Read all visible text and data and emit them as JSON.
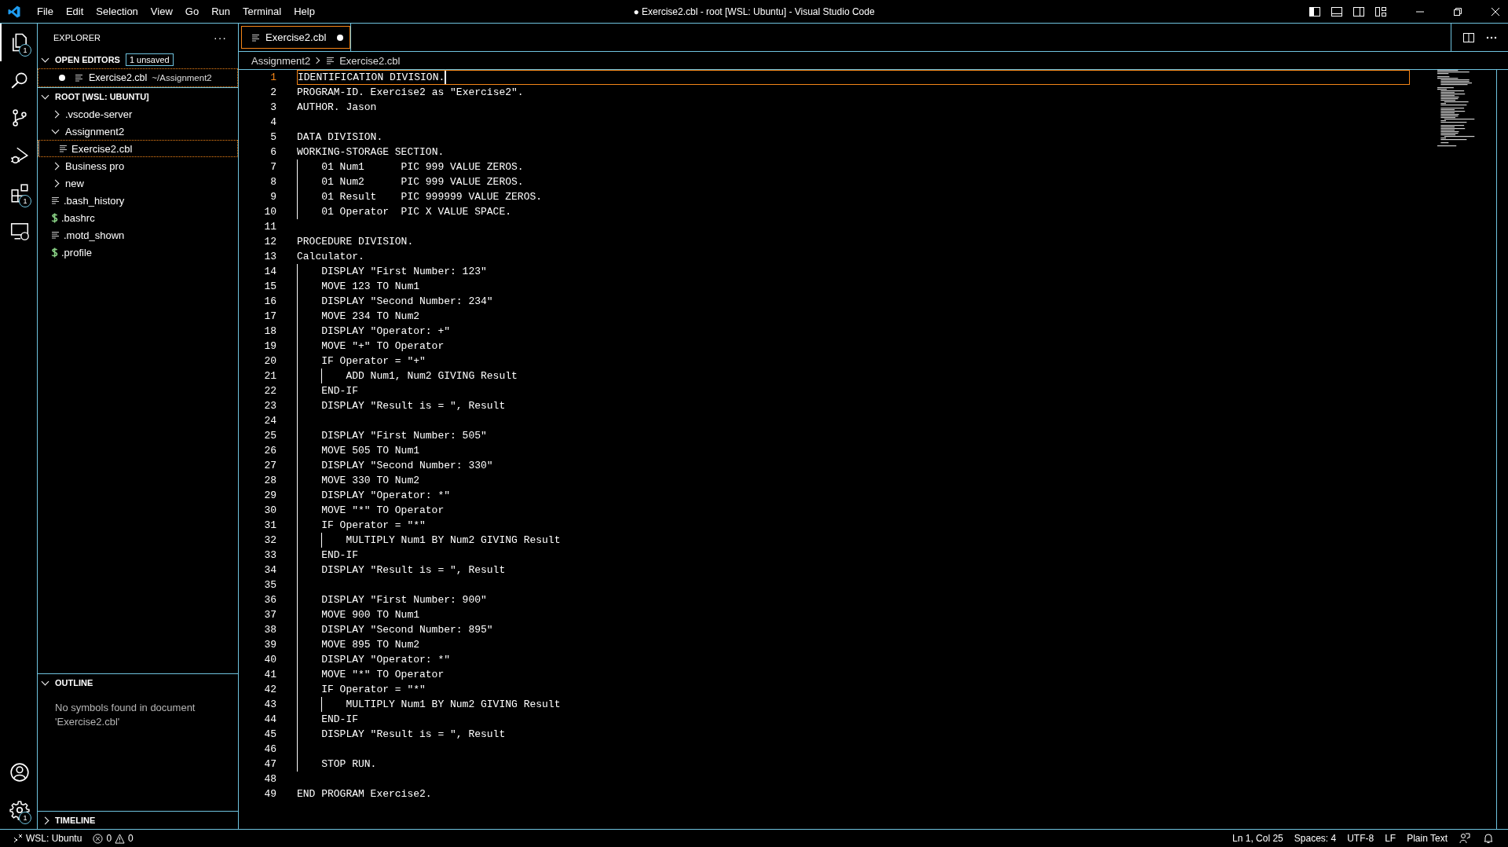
{
  "menu": [
    "File",
    "Edit",
    "Selection",
    "View",
    "Go",
    "Run",
    "Terminal",
    "Help"
  ],
  "window": {
    "title": "● Exercise2.cbl - root [WSL: Ubuntu] - Visual Studio Code"
  },
  "activity_bar": [
    {
      "kind": "files",
      "selected": true,
      "badge": "1"
    },
    {
      "kind": "search",
      "selected": false
    },
    {
      "kind": "source-control",
      "selected": false
    },
    {
      "kind": "run-debug",
      "selected": false
    },
    {
      "kind": "extensions",
      "selected": false,
      "badge": "1"
    },
    {
      "kind": "remote",
      "selected": false
    }
  ],
  "activity_bottom": [
    {
      "kind": "account"
    },
    {
      "kind": "settings",
      "badge": "1"
    }
  ],
  "sidebar": {
    "title": "EXPLORER",
    "more": "···",
    "open_editors": {
      "title": "OPEN EDITORS",
      "badge": "1 unsaved",
      "expanded": true,
      "items": [
        {
          "name": "Exercise2.cbl",
          "path": "~/Assignment2",
          "unsaved": true
        }
      ]
    },
    "root": {
      "title": "ROOT [WSL: UBUNTU]",
      "expanded": true,
      "items": [
        {
          "name": ".vscode-server",
          "kind": "folder",
          "expanded": false,
          "selected": false
        },
        {
          "name": "Assignment2",
          "kind": "folder",
          "expanded": true,
          "selected": false,
          "children": [
            {
              "name": "Exercise2.cbl",
              "kind": "file",
              "selected": true
            }
          ]
        },
        {
          "name": "Business pro",
          "kind": "folder",
          "expanded": false,
          "selected": false
        },
        {
          "name": "new",
          "kind": "folder",
          "expanded": false,
          "selected": false
        },
        {
          "name": ".bash_history",
          "kind": "file",
          "selected": false
        },
        {
          "name": ".bashrc",
          "kind": "shell",
          "selected": false
        },
        {
          "name": ".motd_shown",
          "kind": "file",
          "selected": false
        },
        {
          "name": ".profile",
          "kind": "shell",
          "selected": false
        }
      ]
    },
    "outline": {
      "title": "OUTLINE",
      "expanded": true,
      "message": "No symbols found in document 'Exercise2.cbl'"
    },
    "timeline": {
      "title": "TIMELINE",
      "expanded": false
    }
  },
  "tabs": [
    {
      "label": "Exercise2.cbl",
      "selected": true,
      "unsaved": true
    }
  ],
  "breadcrumb": [
    "Assignment2",
    "Exercise2.cbl"
  ],
  "editor": {
    "lines": [
      {
        "number": "1",
        "text": "IDENTIFICATION DIVISION.",
        "current": true
      },
      {
        "number": "2",
        "text": "PROGRAM-ID. Exercise2 as \"Exercise2\".",
        "current": false
      },
      {
        "number": "3",
        "text": "AUTHOR. Jason",
        "current": false
      },
      {
        "number": "4",
        "current": false
      },
      {
        "number": "5",
        "text": "DATA DIVISION.",
        "current": false
      },
      {
        "number": "6",
        "text": "WORKING-STORAGE SECTION.",
        "current": false
      },
      {
        "number": "7",
        "text": "    01 Num1      PIC 999 VALUE ZEROS.",
        "current": false
      },
      {
        "number": "8",
        "text": "    01 Num2      PIC 999 VALUE ZEROS.",
        "current": false
      },
      {
        "number": "9",
        "text": "    01 Result    PIC 999999 VALUE ZEROS.",
        "current": false
      },
      {
        "number": "10",
        "text": "    01 Operator  PIC X VALUE SPACE.",
        "current": false
      },
      {
        "number": "11",
        "current": false
      },
      {
        "number": "12",
        "text": "PROCEDURE DIVISION.",
        "current": false
      },
      {
        "number": "13",
        "text": "Calculator.",
        "current": false
      },
      {
        "number": "14",
        "text": "    DISPLAY \"First Number: 123\"",
        "current": false
      },
      {
        "number": "15",
        "text": "    MOVE 123 TO Num1",
        "current": false
      },
      {
        "number": "16",
        "text": "    DISPLAY \"Second Number: 234\"",
        "current": false
      },
      {
        "number": "17",
        "text": "    MOVE 234 TO Num2",
        "current": false
      },
      {
        "number": "18",
        "text": "    DISPLAY \"Operator: +\"",
        "current": false
      },
      {
        "number": "19",
        "text": "    MOVE \"+\" TO Operator",
        "current": false
      },
      {
        "number": "20",
        "text": "    IF Operator = \"+\"",
        "current": false
      },
      {
        "number": "21",
        "text": "        ADD Num1, Num2 GIVING Result",
        "current": false
      },
      {
        "number": "22",
        "text": "    END-IF",
        "current": false
      },
      {
        "number": "23",
        "text": "    DISPLAY \"Result is = \", Result",
        "current": false
      },
      {
        "number": "24",
        "current": false
      },
      {
        "number": "25",
        "text": "    DISPLAY \"First Number: 505\"",
        "current": false
      },
      {
        "number": "26",
        "text": "    MOVE 505 TO Num1",
        "current": false
      },
      {
        "number": "27",
        "text": "    DISPLAY \"Second Number: 330\"",
        "current": false
      },
      {
        "number": "28",
        "text": "    MOVE 330 TO Num2",
        "current": false
      },
      {
        "number": "29",
        "text": "    DISPLAY \"Operator: *\"",
        "current": false
      },
      {
        "number": "30",
        "text": "    MOVE \"*\" TO Operator",
        "current": false
      },
      {
        "number": "31",
        "text": "    IF Operator = \"*\"",
        "current": false
      },
      {
        "number": "32",
        "text": "        MULTIPLY Num1 BY Num2 GIVING Result",
        "current": false
      },
      {
        "number": "33",
        "text": "    END-IF",
        "current": false
      },
      {
        "number": "34",
        "text": "    DISPLAY \"Result is = \", Result",
        "current": false
      },
      {
        "number": "35",
        "current": false
      },
      {
        "number": "36",
        "text": "    DISPLAY \"First Number: 900\"",
        "current": false
      },
      {
        "number": "37",
        "text": "    MOVE 900 TO Num1",
        "current": false
      },
      {
        "number": "38",
        "text": "    DISPLAY \"Second Number: 895\"",
        "current": false
      },
      {
        "number": "39",
        "text": "    MOVE 895 TO Num2",
        "current": false
      },
      {
        "number": "40",
        "text": "    DISPLAY \"Operator: *\"",
        "current": false
      },
      {
        "number": "41",
        "text": "    MOVE \"*\" TO Operator",
        "current": false
      },
      {
        "number": "42",
        "text": "    IF Operator = \"*\"",
        "current": false
      },
      {
        "number": "43",
        "text": "        MULTIPLY Num1 BY Num2 GIVING Result",
        "current": false
      },
      {
        "number": "44",
        "text": "    END-IF",
        "current": false
      },
      {
        "number": "45",
        "text": "    DISPLAY \"Result is = \", Result",
        "current": false
      },
      {
        "number": "46",
        "current": false
      },
      {
        "number": "47",
        "text": "    STOP RUN.",
        "current": false
      },
      {
        "number": "48",
        "current": false
      },
      {
        "number": "49",
        "text": "END PROGRAM Exercise2.",
        "current": false
      }
    ]
  },
  "status_bar": {
    "remote": "WSL: Ubuntu",
    "errors": "0",
    "warnings": "0",
    "right": [
      "Ln 1, Col 25",
      "Spaces: 4",
      "UTF-8",
      "LF",
      "Plain Text"
    ]
  }
}
